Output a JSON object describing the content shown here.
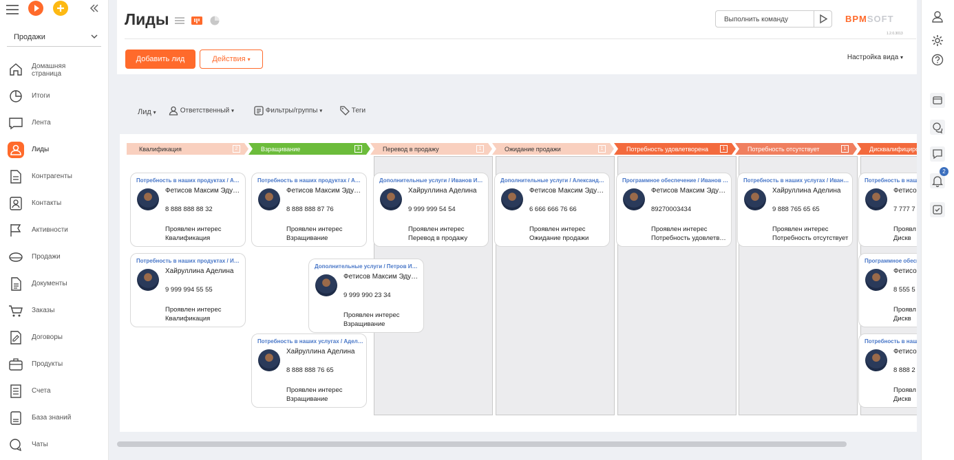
{
  "app": {
    "workspace": "Продажи",
    "logo_main": "BPM",
    "logo_soft": "SOFT",
    "version": "1.2.0.3013"
  },
  "colors": {
    "accent": "#ff6a2b",
    "link": "#4a78c8",
    "stage_green": "#6cbc3b"
  },
  "sidebar": {
    "items": [
      {
        "label": "Домашняя",
        "label2": "страница",
        "icon": "home-icon"
      },
      {
        "label": "Итоги",
        "icon": "pie-chart-icon"
      },
      {
        "label": "Лента",
        "icon": "feed-icon"
      },
      {
        "label": "Лиды",
        "icon": "leads-icon",
        "active": true
      },
      {
        "label": "Контрагенты",
        "icon": "accounts-icon"
      },
      {
        "label": "Контакты",
        "icon": "contacts-icon"
      },
      {
        "label": "Активности",
        "icon": "flag-icon"
      },
      {
        "label": "Продажи",
        "icon": "sales-icon"
      },
      {
        "label": "Документы",
        "icon": "documents-icon"
      },
      {
        "label": "Заказы",
        "icon": "cart-icon"
      },
      {
        "label": "Договоры",
        "icon": "contracts-icon"
      },
      {
        "label": "Продукты",
        "icon": "products-icon"
      },
      {
        "label": "Счета",
        "icon": "invoices-icon"
      },
      {
        "label": "База знаний",
        "icon": "knowledge-base-icon"
      },
      {
        "label": "Чаты",
        "icon": "chats-icon"
      }
    ]
  },
  "header": {
    "title": "Лиды",
    "command_placeholder": "Выполнить команду",
    "add_button": "Добавить лид",
    "actions_button": "Действия",
    "view_settings": "Настройка вида"
  },
  "filters": {
    "lead": "Лид",
    "owner": "Ответственный",
    "filters_groups": "Фильтры/группы",
    "tags": "Теги"
  },
  "stages": [
    {
      "label": "Квалификация",
      "count": "2",
      "color": "#f9d0bf"
    },
    {
      "label": "Взращивание",
      "count": "3",
      "color": "#6cbc3b"
    },
    {
      "label": "Перевод в продажу",
      "count": "1",
      "color": "#f9d0bf"
    },
    {
      "label": "Ожидание продажи",
      "count": "1",
      "color": "#f9d0bf"
    },
    {
      "label": "Потребность удовлетворена",
      "count": "1",
      "color": "#f36a3d"
    },
    {
      "label": "Потребность отсутствует",
      "count": "1",
      "color": "#f07f5f"
    },
    {
      "label": "Дисквалифицирован",
      "count": "",
      "color": "#f36a3d"
    }
  ],
  "cards": [
    {
      "title": "Потребность в наших продуктах / Александрова Ирина",
      "name": "Фетисов Максим Эдуардович",
      "phone": "8 888 888 88 32",
      "status": "Проявлен интерес",
      "stage": "Квалификация"
    },
    {
      "title": "Потребность в наших продуктах / Иванов Иван",
      "name": "Хайруллина Аделина",
      "phone": "9 999 994 55 55",
      "status": "Проявлен интерес",
      "stage": "Квалификация"
    },
    {
      "title": "Потребность в наших продуктах / Александрова Ирина",
      "name": "Фетисов Максим Эдуардович",
      "phone": "8 888 888 87 76",
      "status": "Проявлен интерес",
      "stage": "Взращивание"
    },
    {
      "title": "Дополнительные услуги / Петров Иван",
      "name": "Фетисов Максим Эдуардович",
      "phone": "9 999 990 23 34",
      "status": "Проявлен интерес",
      "stage": "Взращивание"
    },
    {
      "title": "Потребность в наших услугах / Аделина",
      "name": "Хайруллина Аделина",
      "phone": "8 888 888 76 65",
      "status": "Проявлен интерес",
      "stage": "Взращивание"
    },
    {
      "title": "Дополнительные услуги / Иванов Иван",
      "name": "Хайруллина Аделина",
      "phone": "9 999 999 54 54",
      "status": "Проявлен интерес",
      "stage": "Перевод в продажу"
    },
    {
      "title": "Дополнительные услуги / Александрова Ирина",
      "name": "Фетисов Максим Эдуардович",
      "phone": "6 666 666 76 66",
      "status": "Проявлен интерес",
      "stage": "Ожидание продажи"
    },
    {
      "title": "Программное обеспечение / Иванов Иван",
      "name": "Фетисов Максим Эдуардович",
      "phone": "89270003434",
      "status": "Проявлен интерес",
      "stage": "Потребность удовлетворена"
    },
    {
      "title": "Потребность в наших услугах / Иванов Иван",
      "name": "Хайруллина Аделина",
      "phone": "9 888 765 65 65",
      "status": "Проявлен интерес",
      "stage": "Потребность отсутствует"
    },
    {
      "title": "Потребность в наших продуктах",
      "name": "Фетисов",
      "phone": "7 777 7",
      "status": "Проявл",
      "stage": "Дискв"
    },
    {
      "title": "Программное обеспечение",
      "name": "Фетисов",
      "phone": "8 555 5",
      "status": "Проявл",
      "stage": "Дискв"
    },
    {
      "title": "Потребность в наших услугах",
      "name": "Фетисов",
      "phone": "8 888 2",
      "status": "Проявл",
      "stage": "Дискв"
    }
  ],
  "rightbar": {
    "notifications_count": "2"
  }
}
